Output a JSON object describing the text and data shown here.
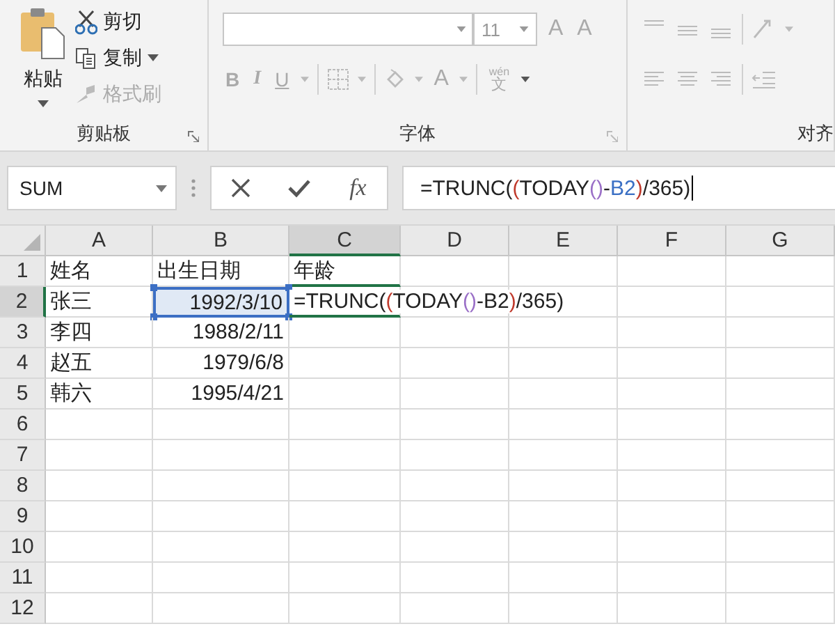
{
  "ribbon": {
    "clipboard": {
      "paste": "粘贴",
      "cut": "剪切",
      "copy": "复制",
      "format_painter": {
        "label": "格式刷",
        "disabled": true
      },
      "group_label": "剪贴板"
    },
    "font": {
      "size": "11",
      "grow": "A",
      "shrink": "A",
      "bold": "B",
      "italic": "I",
      "underline": "U",
      "font_color": "A",
      "phonetic": "wén",
      "phonetic_char": "文",
      "disabled": true,
      "group_label": "字体"
    },
    "alignment": {
      "group_label": "对齐"
    }
  },
  "formula_bar": {
    "name_box": "SUM",
    "fx": "fx",
    "formula": [
      {
        "text": "=TRUNC(",
        "color": "#222222"
      },
      {
        "text": "(",
        "color": "#c0392b"
      },
      {
        "text": "TODAY",
        "color": "#222222"
      },
      {
        "text": "()",
        "color": "#9a6fc7"
      },
      {
        "text": "-",
        "color": "#222222"
      },
      {
        "text": "B2",
        "color": "#3a6fc4"
      },
      {
        "text": ")",
        "color": "#c0392b"
      },
      {
        "text": "/365)",
        "color": "#222222"
      }
    ]
  },
  "sheet": {
    "columns": [
      {
        "label": "A",
        "selected": false
      },
      {
        "label": "B",
        "selected": false
      },
      {
        "label": "C",
        "selected": true
      },
      {
        "label": "D",
        "selected": false
      },
      {
        "label": "E",
        "selected": false
      },
      {
        "label": "F",
        "selected": false
      },
      {
        "label": "G",
        "selected": false
      }
    ],
    "rows": [
      {
        "label": "1",
        "selected": false,
        "cells": [
          {
            "kind": "text",
            "text": "姓名",
            "selected": false
          },
          {
            "kind": "text",
            "text": "出生日期",
            "selected": false
          },
          {
            "kind": "text",
            "text": "年龄",
            "selected": false
          }
        ]
      },
      {
        "label": "2",
        "selected": true,
        "cells": [
          {
            "kind": "text",
            "text": "张三",
            "selected": false
          },
          {
            "kind": "date",
            "text": "1992/3/10",
            "selected": true
          },
          {
            "kind": "formula",
            "selected": false,
            "segments": [
              {
                "text": "=TRUNC(",
                "color": "#222222"
              },
              {
                "text": "(",
                "color": "#c0392b"
              },
              {
                "text": "TODAY",
                "color": "#222222"
              },
              {
                "text": "()",
                "color": "#9a6fc7"
              },
              {
                "text": "-B2",
                "color": "#222222"
              },
              {
                "text": ")",
                "color": "#c0392b"
              },
              {
                "text": "/365)",
                "color": "#222222"
              }
            ]
          }
        ]
      },
      {
        "label": "3",
        "selected": false,
        "cells": [
          {
            "kind": "text",
            "text": "李四",
            "selected": false
          },
          {
            "kind": "date",
            "text": "1988/2/11",
            "selected": false
          }
        ]
      },
      {
        "label": "4",
        "selected": false,
        "cells": [
          {
            "kind": "text",
            "text": "赵五",
            "selected": false
          },
          {
            "kind": "date",
            "text": "1979/6/8",
            "selected": false
          }
        ]
      },
      {
        "label": "5",
        "selected": false,
        "cells": [
          {
            "kind": "text",
            "text": "韩六",
            "selected": false
          },
          {
            "kind": "date",
            "text": "1995/4/21",
            "selected": false
          }
        ]
      },
      {
        "label": "6",
        "selected": false,
        "cells": []
      },
      {
        "label": "7",
        "selected": false,
        "cells": []
      },
      {
        "label": "8",
        "selected": false,
        "cells": []
      },
      {
        "label": "9",
        "selected": false,
        "cells": []
      },
      {
        "label": "10",
        "selected": false,
        "cells": []
      },
      {
        "label": "11",
        "selected": false,
        "cells": []
      },
      {
        "label": "12",
        "selected": false,
        "cells": []
      }
    ]
  }
}
